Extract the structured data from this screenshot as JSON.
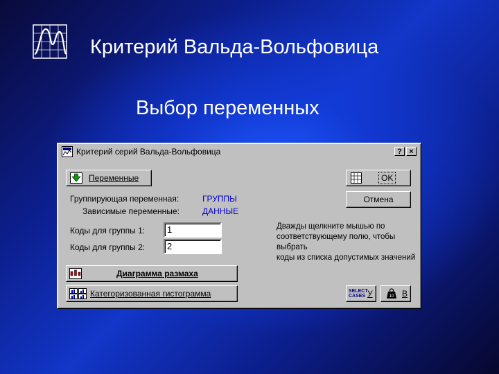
{
  "slide": {
    "title": "Критерий Вальда-Вольфовица",
    "subtitle": "Выбор переменных"
  },
  "dialog": {
    "title": "Критерий серий Вальда-Вольфовица",
    "help_button": "?",
    "close_button": "×",
    "variables_button": "Переменные",
    "ok_button": "OK",
    "cancel_button": "Отмена",
    "grouping_label": "Группирующая переменная:",
    "grouping_value": "ГРУППЫ",
    "dependent_label": "Зависимые переменные:",
    "dependent_value": "ДАННЫЕ",
    "group1_label": "Коды для группы 1:",
    "group1_value": "1",
    "group2_label": "Коды для группы 2:",
    "group2_value": "2",
    "hint_line1": "Дважды щелкните мышью по",
    "hint_line2": "соответствующему полю, чтобы выбрать",
    "hint_line3": "коды из списка допустимых значений",
    "boxplot_button": "Диаграмма размаха",
    "histogram_button": "Категоризованная гистограмма",
    "select_cases_label": "SELECT CASES",
    "select_cases_key": "У",
    "weight_key": "В"
  },
  "colors": {
    "value_text": "#0000c8",
    "background_center": "#1e5aff",
    "background_edge": "#07072e",
    "dialog_face": "#c0c0c0"
  },
  "icons": {
    "logo": "statistica-curve-logo",
    "dialog": "statistica-app-icon",
    "variables": "green-arrow-icon",
    "ok": "grid-table-icon",
    "boxplot": "boxplot-icon",
    "histogram": "categorized-histogram-icon",
    "weight": "weight-icon"
  }
}
